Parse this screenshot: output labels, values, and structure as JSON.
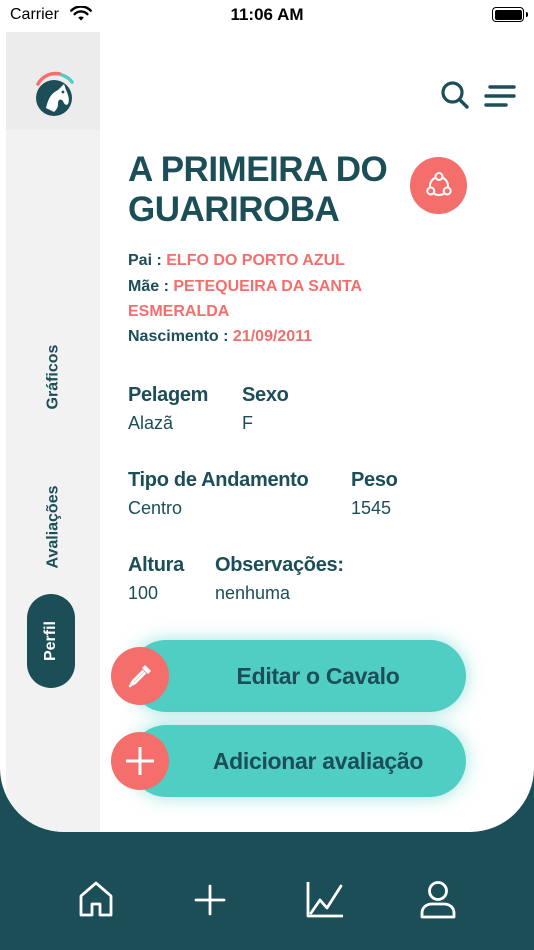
{
  "status_bar": {
    "carrier": "Carrier",
    "time": "11:06 AM"
  },
  "sidebar": {
    "tabs": [
      {
        "label": "Gráficos"
      },
      {
        "label": "Avaliações"
      },
      {
        "label": "Perfil",
        "active": true
      }
    ]
  },
  "horse": {
    "name": "A PRIMEIRA DO GUARIROBA",
    "pai_label": "Pai :",
    "pai": "ELFO DO PORTO AZUL",
    "mae_label": "Mãe :",
    "mae": "PETEQUEIRA DA SANTA ESMERALDA",
    "nascimento_label": "Nascimento :",
    "nascimento": "21/09/2011",
    "attributes": {
      "pelagem": {
        "label": "Pelagem",
        "value": "Alazã"
      },
      "sexo": {
        "label": "Sexo",
        "value": "F"
      },
      "andamento": {
        "label": "Tipo de Andamento",
        "value": "Centro"
      },
      "peso": {
        "label": "Peso",
        "value": "1545"
      },
      "altura": {
        "label": "Altura",
        "value": "100"
      },
      "observacoes": {
        "label": "Observações:",
        "value": "nenhuma"
      }
    }
  },
  "actions": {
    "edit_label": "Editar o Cavalo",
    "add_label": "Adicionar avaliação"
  },
  "icons": {
    "top": [
      "search-icon",
      "menu-icon"
    ],
    "nav": [
      "home-icon",
      "plus-icon",
      "chart-icon",
      "user-icon"
    ],
    "actions": [
      "eyedropper-icon",
      "plus-icon"
    ],
    "share": "share-icon"
  },
  "colors": {
    "primary": "#1c4e58",
    "accent": "#f46e6c",
    "teal": "#50cec4",
    "sidebar": "#f2f2f2"
  }
}
